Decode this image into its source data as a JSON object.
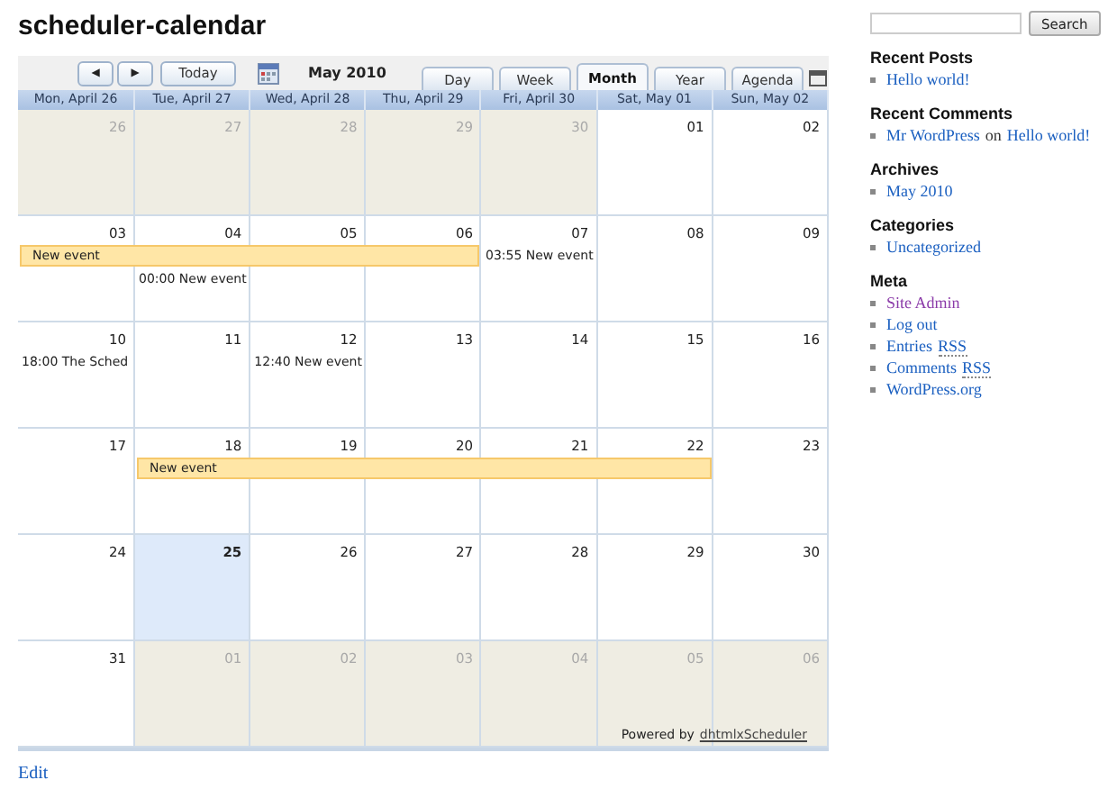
{
  "page_title": "scheduler-calendar",
  "toolbar": {
    "prev": "◀",
    "next": "▶",
    "today": "Today",
    "date": "May 2010"
  },
  "tabs": [
    {
      "label": "Day",
      "selected": false
    },
    {
      "label": "Week",
      "selected": false
    },
    {
      "label": "Month",
      "selected": true
    },
    {
      "label": "Year",
      "selected": false
    },
    {
      "label": "Agenda",
      "selected": false
    }
  ],
  "columns": [
    "Mon, April 26",
    "Tue, April 27",
    "Wed, April 28",
    "Thu, April 29",
    "Fri, April 30",
    "Sat, May 01",
    "Sun, May 02"
  ],
  "weeks": [
    {
      "days": [
        {
          "label": "26",
          "in_month": false,
          "today": false,
          "in_bar": false
        },
        {
          "label": "27",
          "in_month": false,
          "today": false,
          "in_bar": false
        },
        {
          "label": "28",
          "in_month": false,
          "today": false,
          "in_bar": false
        },
        {
          "label": "29",
          "in_month": false,
          "today": false,
          "in_bar": false
        },
        {
          "label": "30",
          "in_month": false,
          "today": false,
          "in_bar": false
        },
        {
          "label": "01",
          "in_month": true,
          "today": false,
          "in_bar": false
        },
        {
          "label": "02",
          "in_month": true,
          "today": false,
          "in_bar": false
        }
      ]
    },
    {
      "days": [
        {
          "label": "03",
          "in_month": true,
          "today": false,
          "in_bar": true,
          "bar_text": "New event"
        },
        {
          "label": "04",
          "in_month": true,
          "today": false,
          "in_bar": true,
          "events": [
            "00:00 New event"
          ]
        },
        {
          "label": "05",
          "in_month": true,
          "today": false,
          "in_bar": true
        },
        {
          "label": "06",
          "in_month": true,
          "today": false,
          "in_bar": true
        },
        {
          "label": "07",
          "in_month": true,
          "today": false,
          "in_bar": false,
          "events": [
            "03:55 New event"
          ]
        },
        {
          "label": "08",
          "in_month": true,
          "today": false,
          "in_bar": false
        },
        {
          "label": "09",
          "in_month": true,
          "today": false,
          "in_bar": false
        }
      ]
    },
    {
      "days": [
        {
          "label": "10",
          "in_month": true,
          "today": false,
          "in_bar": false,
          "events": [
            "18:00 The Sched"
          ]
        },
        {
          "label": "11",
          "in_month": true,
          "today": false,
          "in_bar": false
        },
        {
          "label": "12",
          "in_month": true,
          "today": false,
          "in_bar": false,
          "events": [
            "12:40 New event"
          ]
        },
        {
          "label": "13",
          "in_month": true,
          "today": false,
          "in_bar": false
        },
        {
          "label": "14",
          "in_month": true,
          "today": false,
          "in_bar": false
        },
        {
          "label": "15",
          "in_month": true,
          "today": false,
          "in_bar": false
        },
        {
          "label": "16",
          "in_month": true,
          "today": false,
          "in_bar": false
        }
      ]
    },
    {
      "days": [
        {
          "label": "17",
          "in_month": true,
          "today": false,
          "in_bar": false
        },
        {
          "label": "18",
          "in_month": true,
          "today": false,
          "in_bar": true,
          "bar_text": "New event"
        },
        {
          "label": "19",
          "in_month": true,
          "today": false,
          "in_bar": true
        },
        {
          "label": "20",
          "in_month": true,
          "today": false,
          "in_bar": true
        },
        {
          "label": "21",
          "in_month": true,
          "today": false,
          "in_bar": true
        },
        {
          "label": "22",
          "in_month": true,
          "today": false,
          "in_bar": true
        },
        {
          "label": "23",
          "in_month": true,
          "today": false,
          "in_bar": false
        }
      ]
    },
    {
      "days": [
        {
          "label": "24",
          "in_month": true,
          "today": false,
          "in_bar": false
        },
        {
          "label": "25",
          "in_month": true,
          "today": true,
          "in_bar": false
        },
        {
          "label": "26",
          "in_month": true,
          "today": false,
          "in_bar": false
        },
        {
          "label": "27",
          "in_month": true,
          "today": false,
          "in_bar": false
        },
        {
          "label": "28",
          "in_month": true,
          "today": false,
          "in_bar": false
        },
        {
          "label": "29",
          "in_month": true,
          "today": false,
          "in_bar": false
        },
        {
          "label": "30",
          "in_month": true,
          "today": false,
          "in_bar": false
        }
      ]
    },
    {
      "days": [
        {
          "label": "31",
          "in_month": true,
          "today": false,
          "in_bar": false
        },
        {
          "label": "01",
          "in_month": false,
          "today": false,
          "in_bar": false
        },
        {
          "label": "02",
          "in_month": false,
          "today": false,
          "in_bar": false
        },
        {
          "label": "03",
          "in_month": false,
          "today": false,
          "in_bar": false
        },
        {
          "label": "04",
          "in_month": false,
          "today": false,
          "in_bar": false
        },
        {
          "label": "05",
          "in_month": false,
          "today": false,
          "in_bar": false
        },
        {
          "label": "06",
          "in_month": false,
          "today": false,
          "in_bar": false
        }
      ]
    }
  ],
  "powered_by": {
    "text": "Powered by",
    "link": "dhtmlxScheduler"
  },
  "edit_link": "Edit",
  "sidebar": {
    "search_button": "Search",
    "sections": [
      {
        "title": "Recent Posts",
        "items": [
          [
            {
              "text": "Hello world!",
              "kind": "link"
            }
          ]
        ]
      },
      {
        "title": "Recent Comments",
        "items": [
          [
            {
              "text": "Mr WordPress",
              "kind": "link"
            },
            {
              "text": "on",
              "kind": "plain"
            },
            {
              "text": "Hello world!",
              "kind": "link"
            }
          ]
        ]
      },
      {
        "title": "Archives",
        "items": [
          [
            {
              "text": "May 2010",
              "kind": "link"
            }
          ]
        ]
      },
      {
        "title": "Categories",
        "items": [
          [
            {
              "text": "Uncategorized",
              "kind": "link"
            }
          ]
        ]
      },
      {
        "title": "Meta",
        "items": [
          [
            {
              "text": "Site Admin",
              "kind": "visited"
            }
          ],
          [
            {
              "text": "Log out",
              "kind": "link"
            }
          ],
          [
            {
              "text": "Entries",
              "kind": "link"
            },
            {
              "text": "RSS",
              "kind": "abbr"
            }
          ],
          [
            {
              "text": "Comments",
              "kind": "link"
            },
            {
              "text": "RSS",
              "kind": "abbr"
            }
          ],
          [
            {
              "text": "WordPress.org",
              "kind": "link"
            }
          ]
        ]
      }
    ]
  }
}
